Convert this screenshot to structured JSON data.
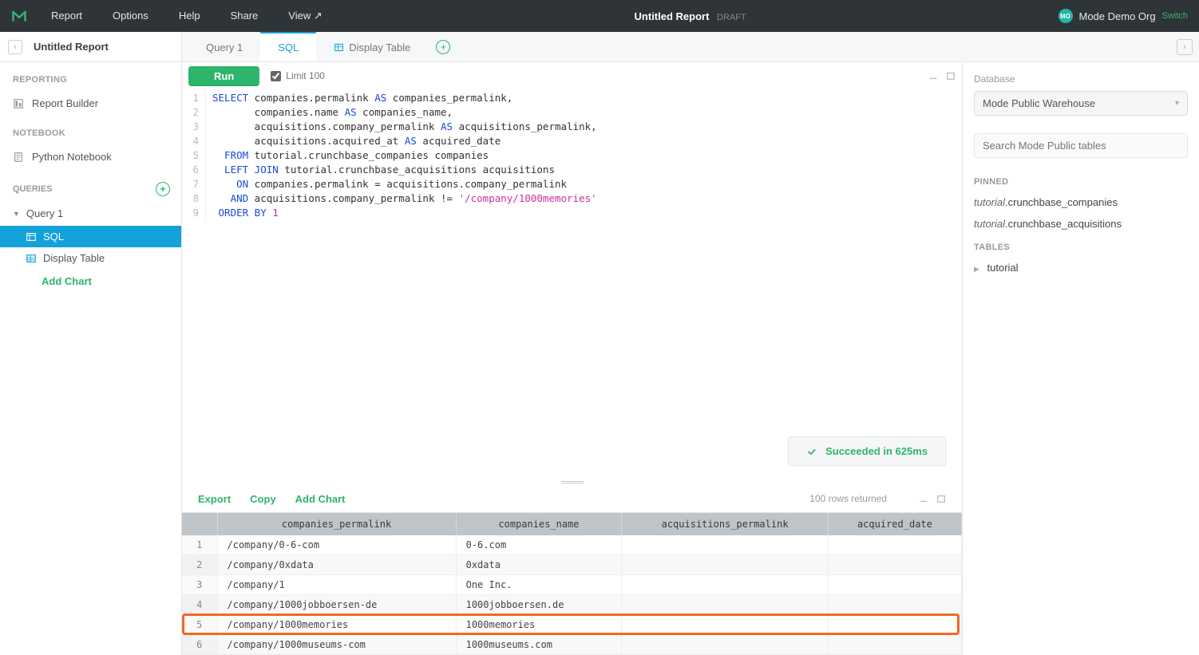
{
  "topbar": {
    "menu": [
      "Report",
      "Options",
      "Help",
      "Share",
      "View ↗"
    ],
    "title": "Untitled Report",
    "draft": "DRAFT",
    "org_badge": "MO",
    "org_name": "Mode Demo Org",
    "switch": "Switch"
  },
  "sidebar": {
    "title": "Untitled Report",
    "sections": {
      "reporting": "REPORTING",
      "notebook": "NOTEBOOK",
      "queries": "QUERIES"
    },
    "report_builder": "Report Builder",
    "python_notebook": "Python Notebook",
    "query1": "Query 1",
    "sql": "SQL",
    "display_table": "Display Table",
    "add_chart": "Add Chart"
  },
  "tabs": {
    "query1": "Query 1",
    "sql": "SQL",
    "display_table": "Display Table"
  },
  "toolbar": {
    "run": "Run",
    "limit_label": "Limit 100"
  },
  "sql_lines": [
    {
      "n": "1",
      "segments": [
        {
          "t": "SELECT",
          "c": "kw"
        },
        {
          "t": " companies.permalink "
        },
        {
          "t": "AS",
          "c": "kw"
        },
        {
          "t": " companies_permalink,"
        }
      ]
    },
    {
      "n": "2",
      "segments": [
        {
          "t": "       companies.name "
        },
        {
          "t": "AS",
          "c": "kw"
        },
        {
          "t": " companies_name,"
        }
      ]
    },
    {
      "n": "3",
      "segments": [
        {
          "t": "       acquisitions.company_permalink "
        },
        {
          "t": "AS",
          "c": "kw"
        },
        {
          "t": " acquisitions_permalink,"
        }
      ]
    },
    {
      "n": "4",
      "segments": [
        {
          "t": "       acquisitions.acquired_at "
        },
        {
          "t": "AS",
          "c": "kw"
        },
        {
          "t": " acquired_date"
        }
      ]
    },
    {
      "n": "5",
      "segments": [
        {
          "t": "  FROM",
          "c": "kw"
        },
        {
          "t": " tutorial.crunchbase_companies companies"
        }
      ]
    },
    {
      "n": "6",
      "segments": [
        {
          "t": "  LEFT JOIN",
          "c": "kw"
        },
        {
          "t": " tutorial.crunchbase_acquisitions acquisitions"
        }
      ]
    },
    {
      "n": "7",
      "segments": [
        {
          "t": "    ON",
          "c": "kw"
        },
        {
          "t": " companies.permalink = acquisitions.company_permalink"
        }
      ]
    },
    {
      "n": "8",
      "segments": [
        {
          "t": "   AND",
          "c": "kw"
        },
        {
          "t": " acquisitions.company_permalink != "
        },
        {
          "t": "'/company/1000memories'",
          "c": "str"
        }
      ]
    },
    {
      "n": "9",
      "segments": [
        {
          "t": " ORDER BY",
          "c": "kw"
        },
        {
          "t": " "
        },
        {
          "t": "1",
          "c": "num"
        }
      ]
    }
  ],
  "status": "Succeeded in 625ms",
  "results_actions": {
    "export": "Export",
    "copy": "Copy",
    "add_chart": "Add Chart",
    "rows_returned": "100 rows returned"
  },
  "columns": [
    "companies_permalink",
    "companies_name",
    "acquisitions_permalink",
    "acquired_date"
  ],
  "rows": [
    {
      "n": "1",
      "cells": [
        "/company/0-6-com",
        "0-6.com",
        "",
        ""
      ]
    },
    {
      "n": "2",
      "cells": [
        "/company/0xdata",
        "0xdata",
        "",
        ""
      ]
    },
    {
      "n": "3",
      "cells": [
        "/company/1",
        "One Inc.",
        "",
        ""
      ]
    },
    {
      "n": "4",
      "cells": [
        "/company/1000jobboersen-de",
        "1000jobboersen.de",
        "",
        ""
      ]
    },
    {
      "n": "5",
      "cells": [
        "/company/1000memories",
        "1000memories",
        "",
        ""
      ],
      "highlight": true
    },
    {
      "n": "6",
      "cells": [
        "/company/1000museums-com",
        "1000museums.com",
        "",
        ""
      ]
    }
  ],
  "right": {
    "database_label": "Database",
    "database_value": "Mode Public Warehouse",
    "search_placeholder": "Search Mode Public tables",
    "pinned_label": "PINNED",
    "pinned": [
      {
        "prefix": "tutorial",
        "name": ".crunchbase_companies"
      },
      {
        "prefix": "tutorial",
        "name": ".crunchbase_acquisitions"
      }
    ],
    "tables_label": "TABLES",
    "tables": [
      "tutorial"
    ]
  }
}
